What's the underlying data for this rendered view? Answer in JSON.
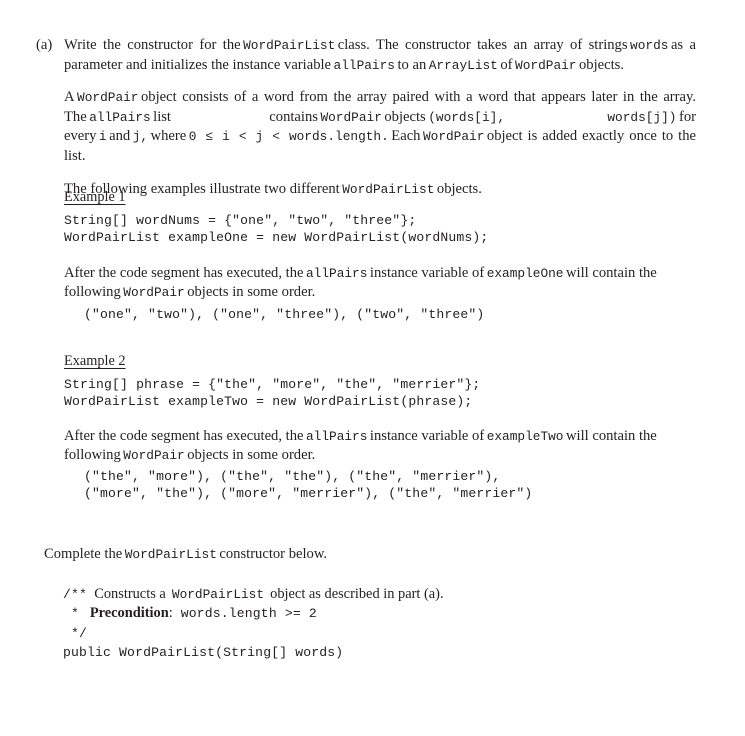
{
  "part": {
    "label": "(a)",
    "paragraph1": {
      "s1": "Write the constructor for the",
      "c1": "WordPairList",
      "s2": "class. The constructor takes an array of strings",
      "c2": "words",
      "s3": "as a parameter and initializes the instance variable",
      "c3": "allPairs",
      "s4": "to an",
      "c4": "ArrayList",
      "s5": "of",
      "c5": "WordPair",
      "s6": "objects."
    },
    "paragraph2": {
      "s1": "A",
      "c1": "WordPair",
      "s2": "object consists of a word from the array paired with a word that appears later in the array. The",
      "c2": "allPairs",
      "s3": "list contains",
      "c3": "WordPair",
      "s4": "objects",
      "c4": "(words[i], words[j])",
      "s5": "for every",
      "c5": "i",
      "s6": "and",
      "c6": "j,",
      "s7": "where",
      "c7": "0 ≤ i < j < words.length.",
      "s8": "Each",
      "c8": "WordPair",
      "s9": "object is added exactly once to the list."
    },
    "paragraph3": {
      "s1": "The following examples illustrate two different",
      "c1": "WordPairList",
      "s2": "objects."
    }
  },
  "example1": {
    "title": "Example 1",
    "code": "String[] wordNums = {\"one\", \"two\", \"three\"};\nWordPairList exampleOne = new WordPairList(wordNums);",
    "description": {
      "s1": "After the code segment has executed, the",
      "c1": "allPairs",
      "s2": "instance variable of",
      "c2": "exampleOne",
      "s3": "will contain the following",
      "c3": "WordPair",
      "s4": "objects in some order."
    },
    "pairs": "(\"one\", \"two\"), (\"one\", \"three\"), (\"two\", \"three\")"
  },
  "example2": {
    "title": "Example 2",
    "code": "String[] phrase = {\"the\", \"more\", \"the\", \"merrier\"};\nWordPairList exampleTwo = new WordPairList(phrase);",
    "description": {
      "s1": "After the code segment has executed, the",
      "c1": "allPairs",
      "s2": "instance variable of",
      "c2": "exampleTwo",
      "s3": "will contain the following",
      "c3": "WordPair",
      "s4": "objects in some order."
    },
    "pairs": "(\"the\", \"more\"), (\"the\", \"the\"), (\"the\", \"merrier\"),\n(\"more\", \"the\"), (\"more\", \"merrier\"), (\"the\", \"merrier\")"
  },
  "closing": {
    "s1": "Complete the",
    "c1": "WordPairList",
    "s2": "constructor below."
  },
  "signature": {
    "doc_open": "/**",
    "doc_text_1": "Constructs a",
    "doc_code_1": "WordPairList",
    "doc_text_2": "object as described in part (a).",
    "doc_star": "*",
    "doc_precondition_label": "Precondition",
    "doc_precondition_colon": ":",
    "doc_precondition_code": "words.length >= 2",
    "doc_close": "*/",
    "declaration": "public WordPairList(String[] words)"
  }
}
